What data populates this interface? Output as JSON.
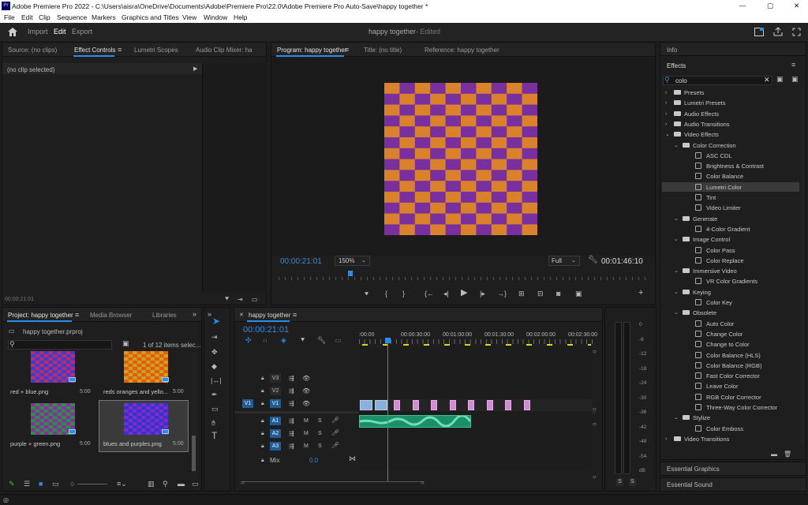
{
  "window": {
    "app_badge": "Pr",
    "title": "Adobe Premiere Pro 2022 - C:\\Users\\aisra\\OneDrive\\Documents\\Adobe\\Premiere Pro\\22.0\\Adobe Premiere Pro Auto-Save\\happy together *",
    "minimize": "—",
    "maximize": "▢",
    "close": "✕"
  },
  "menu": [
    "File",
    "Edit",
    "Clip",
    "Sequence",
    "Markers",
    "Graphics and Titles",
    "View",
    "Window",
    "Help"
  ],
  "workspace": {
    "tabs": [
      "Import",
      "Edit",
      "Export"
    ],
    "active": "Edit",
    "project_name": "happy together",
    "status": "- Edited"
  },
  "source_panel": {
    "tabs": [
      "Source: (no clips)",
      "Effect Controls",
      "Lumetri Scopes",
      "Audio Clip Mixer: ha"
    ],
    "active_tab": "Effect Controls",
    "message": "(no clip selected)",
    "timecode": "00:00:21:01"
  },
  "program": {
    "tabs": [
      "Program: happy together",
      "Title: (no title)",
      "Reference: happy together"
    ],
    "timecode": "00:00:21:01",
    "zoom": "150%",
    "quality": "Full",
    "duration": "00:01:46:10",
    "checker_colors": [
      "#d9822b",
      "#7a2f9e"
    ]
  },
  "effects": {
    "info_tab": "Info",
    "title": "Effects",
    "search_value": "colo",
    "tree": [
      {
        "label": "Presets",
        "level": 0,
        "kind": "folder",
        "open": false
      },
      {
        "label": "Lumetri Presets",
        "level": 0,
        "kind": "folder",
        "open": false
      },
      {
        "label": "Audio Effects",
        "level": 0,
        "kind": "folder",
        "open": false
      },
      {
        "label": "Audio Transitions",
        "level": 0,
        "kind": "folder",
        "open": false
      },
      {
        "label": "Video Effects",
        "level": 0,
        "kind": "folder",
        "open": true
      },
      {
        "label": "Color Correction",
        "level": 1,
        "kind": "folder",
        "open": true
      },
      {
        "label": "ASC CDL",
        "level": 2,
        "kind": "fx"
      },
      {
        "label": "Brightness & Contrast",
        "level": 2,
        "kind": "fx"
      },
      {
        "label": "Color Balance",
        "level": 2,
        "kind": "fx"
      },
      {
        "label": "Lumetri Color",
        "level": 2,
        "kind": "fx",
        "selected": true
      },
      {
        "label": "Tint",
        "level": 2,
        "kind": "fx"
      },
      {
        "label": "Video Limiter",
        "level": 2,
        "kind": "fx"
      },
      {
        "label": "Generate",
        "level": 1,
        "kind": "folder",
        "open": true
      },
      {
        "label": "4-Color Gradient",
        "level": 2,
        "kind": "fx"
      },
      {
        "label": "Image Control",
        "level": 1,
        "kind": "folder",
        "open": true
      },
      {
        "label": "Color Pass",
        "level": 2,
        "kind": "fx"
      },
      {
        "label": "Color Replace",
        "level": 2,
        "kind": "fx"
      },
      {
        "label": "Immersive Video",
        "level": 1,
        "kind": "folder",
        "open": true
      },
      {
        "label": "VR Color Gradients",
        "level": 2,
        "kind": "fx"
      },
      {
        "label": "Keying",
        "level": 1,
        "kind": "folder",
        "open": true
      },
      {
        "label": "Color Key",
        "level": 2,
        "kind": "fx"
      },
      {
        "label": "Obsolete",
        "level": 1,
        "kind": "folder",
        "open": true
      },
      {
        "label": "Auto Color",
        "level": 2,
        "kind": "fx"
      },
      {
        "label": "Change Color",
        "level": 2,
        "kind": "fx"
      },
      {
        "label": "Change to Color",
        "level": 2,
        "kind": "fx"
      },
      {
        "label": "Color Balance (HLS)",
        "level": 2,
        "kind": "fx"
      },
      {
        "label": "Color Balance (RGB)",
        "level": 2,
        "kind": "fx"
      },
      {
        "label": "Fast Color Corrector",
        "level": 2,
        "kind": "fx"
      },
      {
        "label": "Leave Color",
        "level": 2,
        "kind": "fx"
      },
      {
        "label": "RGB Color Corrector",
        "level": 2,
        "kind": "fx"
      },
      {
        "label": "Three-Way Color Corrector",
        "level": 2,
        "kind": "fx"
      },
      {
        "label": "Stylize",
        "level": 1,
        "kind": "folder",
        "open": true
      },
      {
        "label": "Color Emboss",
        "level": 2,
        "kind": "fx"
      },
      {
        "label": "Video Transitions",
        "level": 0,
        "kind": "folder",
        "open": false
      }
    ],
    "essential_graphics": "Essential Graphics",
    "essential_sound": "Essential Sound"
  },
  "project": {
    "tabs": [
      "Project: happy together",
      "Media Browser",
      "Libraries"
    ],
    "file": "happy together.prproj",
    "count": "1 of 12 items selec...",
    "items": [
      {
        "name": "red + blue.png",
        "dur": "5:00",
        "c1": "#3a3fd0",
        "c2": "#c2296a",
        "selected": false
      },
      {
        "name": "reds oranges and yello...",
        "dur": "5:00",
        "c1": "#e85a12",
        "c2": "#c9a41e",
        "selected": false
      },
      {
        "name": "purple + green.png",
        "dur": "5:00",
        "c1": "#2f8c4a",
        "c2": "#8a2fa0",
        "selected": false
      },
      {
        "name": "blues and purples.png",
        "dur": "5:00",
        "c1": "#3a2fd0",
        "c2": "#7a2fc4",
        "selected": true
      }
    ]
  },
  "timeline": {
    "sequence": "happy together",
    "timecode": "00:00:21:01",
    "ruler": [
      ":00:00",
      "00:00:30:00",
      "00:01:00:00",
      "00:01:30:00",
      "00:02:00:00",
      "00:02:30:00"
    ],
    "video_tracks": [
      "V3",
      "V2",
      "V1"
    ],
    "audio_tracks": [
      "A1",
      "A2",
      "A3"
    ],
    "source_patch_v": "V1",
    "mix_label": "Mix",
    "mix_value": "0.0",
    "track_buttons": {
      "mute": "M",
      "solo": "S"
    }
  },
  "meter": {
    "scale": [
      "0",
      "-6",
      "-12",
      "-18",
      "-24",
      "-30",
      "-36",
      "-42",
      "-48",
      "-54",
      "dB"
    ],
    "solo_buttons": [
      "S",
      "S"
    ]
  }
}
